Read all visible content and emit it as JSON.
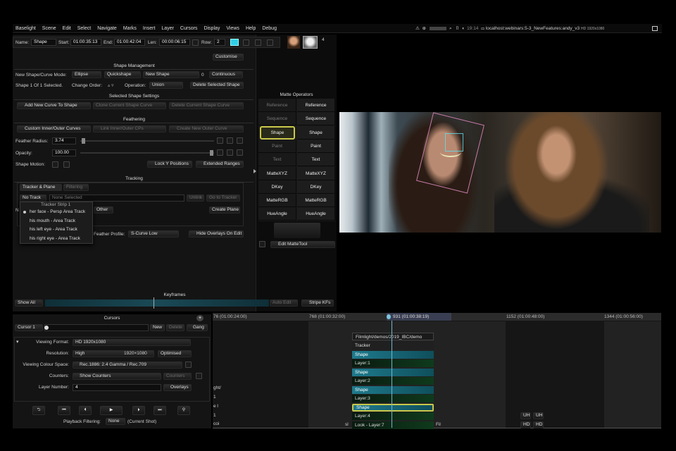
{
  "menu": [
    "Baselight",
    "Scene",
    "Edit",
    "Select",
    "Navigate",
    "Marks",
    "Insert",
    "Layer",
    "Cursors",
    "Display",
    "Views",
    "Help",
    "Debug"
  ],
  "status": {
    "time": "19:14",
    "url": "localhost:webinars:5-3_NewFeatures:andy_v3",
    "format": "HD 1920x1080"
  },
  "shape_bar": {
    "name_label": "Name:",
    "name": "Shape",
    "start_label": "Start:",
    "start": "01:00:35:13",
    "end_label": "End:",
    "end": "01:00:42:04",
    "len_label": "Len:",
    "len": "00:00:06:15",
    "row_label": "Row:",
    "row": "2",
    "stack": "4"
  },
  "customise": "Customise",
  "shape_mgmt": {
    "title": "Shape Management",
    "mode_label": "New Shape/Curve Mode:",
    "mode": "Ellipse",
    "quickshape": "Quickshape",
    "new_shape": "New Shape",
    "new_shape_count": "0",
    "continuous": "Continuous",
    "selected_info": "Shape 1 Of 1 Selected.",
    "change_order": "Change Order:",
    "operation_label": "Operation:",
    "operation": "Union",
    "delete_selected": "Delete Selected Shape"
  },
  "selected_settings": {
    "title": "Selected Shape Settings",
    "add_curve": "Add New Curve To Shape",
    "clone_curve": "Clone Current Shape Curve",
    "delete_curve": "Delete Current Shape Curve"
  },
  "feathering": {
    "title": "Feathering",
    "custom": "Custom Inner/Outer Curves",
    "link": "Link Inner/Outer CPs",
    "create_outer": "Create New Outer Curve",
    "radius_label": "Feather Radius:",
    "radius": "3.74",
    "opacity_label": "Opacity:",
    "opacity": "100.00",
    "motion_label": "Shape Motion:",
    "lock_y": "Lock Y Positions",
    "extended": "Extended Ranges"
  },
  "tracking": {
    "title": "Tracking",
    "tab_tracker": "Tracker & Plane",
    "tab_filtering": "Filtering",
    "track_select": "No Track",
    "track_value": "None Selected",
    "unlink": "Unlink",
    "goto": "Go to Tracker",
    "other": "Other",
    "create_plane": "Create Plane",
    "feather_profile_label": "Feather Profile:",
    "feather_profile": "S-Curve Low",
    "hide_overlays": "Hide Overlays On Edit",
    "dropdown": {
      "header": "Tracker Strip 1",
      "items": [
        "her face - Persp Area Track",
        "his mouth - Area Track",
        "his left eye - Area Track",
        "his right eye - Area Track"
      ]
    }
  },
  "matte_ops": {
    "title": "Matte Operators",
    "left": [
      "Reference",
      "Sequence",
      "Shape",
      "Paint",
      "Text",
      "MatteXYZ",
      "DKey",
      "MatteRGB",
      "HueAngle"
    ],
    "right": [
      "Reference",
      "Sequence",
      "Shape",
      "Paint",
      "Text",
      "MatteXYZ",
      "DKey",
      "MatteRGB",
      "HueAngle"
    ],
    "edit_matte": "Edit MatteTool"
  },
  "keyframes": {
    "title": "Keyframes",
    "show": "Show All",
    "auto_edit": "Auto Edit",
    "stripe": "Stripe KFs"
  },
  "cursors": {
    "title": "Cursors",
    "cursor": "Cursor 1",
    "new": "New",
    "delete": "Delete",
    "gang": "Gang",
    "format_label": "Viewing Format:",
    "format": "HD 1920x1080",
    "res_label": "Resolution:",
    "res": "High",
    "res_size": "1920×1080",
    "optimised": "Optimised",
    "colour_label": "Viewing Colour Space:",
    "colour": "Rec.1886: 2.4 Gamma / Rec.709",
    "counters_label": "Counters:",
    "counters": "Show Counters",
    "counters2": "Counters",
    "layer_label": "Layer Number:",
    "layer": "4",
    "overlays": "Overlays",
    "playback_label": "Playback Filtering:",
    "playback": "None",
    "playback_note": "(Current Shot)"
  },
  "timeline": {
    "ruler": [
      "76 (01:00:24:00)",
      "768 (01:00:32:00)",
      "931 (01:00:38:19)",
      "1152 (01:00:48:00)",
      "1344 (01:00:56:00)"
    ],
    "path": "Filmlight/demos/2019_IBC/demo",
    "stack": [
      "Tracker",
      "Shape",
      "Layer:1",
      "Shape",
      "Layer:2",
      "Shape",
      "Layer:3",
      "Shape",
      "Layer:4",
      "Look - Layer:7"
    ],
    "left_frag": [
      "ght/",
      "1",
      "e l",
      "1",
      "coi"
    ],
    "sl": "sl",
    "fil": "Fil",
    "uh": "UH",
    "hd": "HD"
  },
  "accent": "#1e7a8c",
  "select_color": "#c8c84a"
}
